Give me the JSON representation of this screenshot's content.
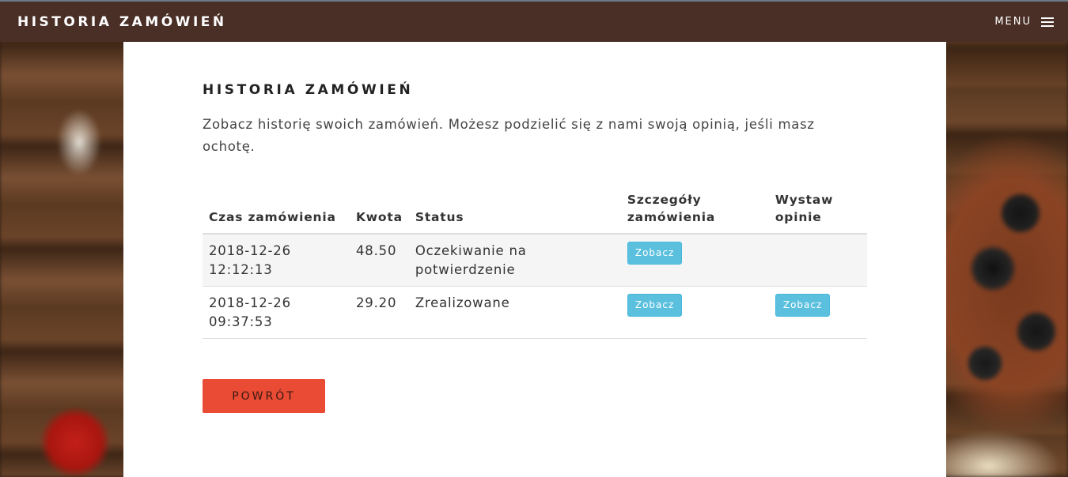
{
  "header": {
    "brand": "HISTORIA ZAMÓWIEŃ",
    "menu_label": "MENU",
    "menu_icon": "hamburger-icon"
  },
  "main": {
    "title": "HISTORIA ZAMÓWIEŃ",
    "intro": "Zobacz historię swoich zamówień. Możesz podzielić się z nami swoją opinią, jeśli masz ochotę.",
    "table": {
      "columns": [
        "Czas zamówienia",
        "Kwota",
        "Status",
        "Szczegóły zamówienia",
        "Wystaw opinie"
      ],
      "rows": [
        {
          "time": "2018-12-26 12:12:13",
          "amount": "48.50",
          "status": "Oczekiwanie na potwierdzenie",
          "details_button": "Zobacz",
          "review_button": null
        },
        {
          "time": "2018-12-26 09:37:53",
          "amount": "29.20",
          "status": "Zrealizowane",
          "details_button": "Zobacz",
          "review_button": "Zobacz"
        }
      ]
    },
    "back_button": "POWRÓT"
  },
  "colors": {
    "topbar": "#4a2f26",
    "info_button": "#5bc0de",
    "back_button": "#e94b35"
  }
}
